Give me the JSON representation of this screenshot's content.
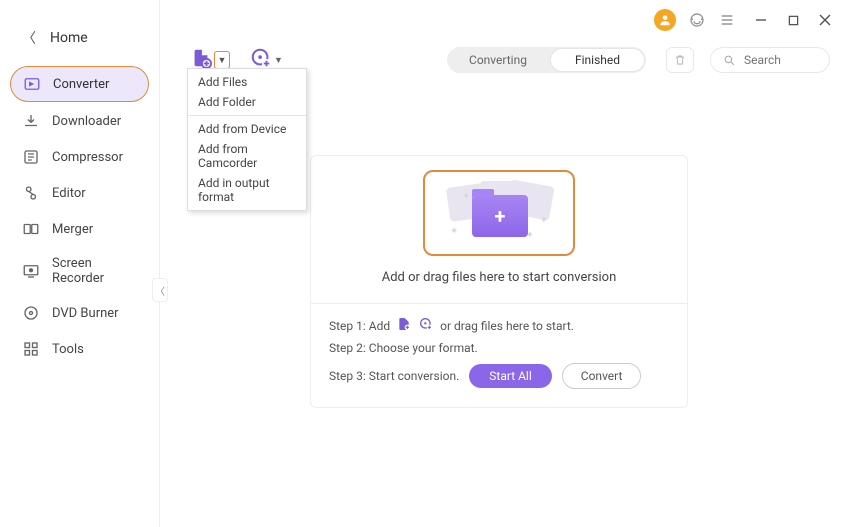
{
  "titlebar": {
    "avatar_initial": ""
  },
  "sidebar": {
    "home_label": "Home",
    "items": [
      {
        "label": "Converter",
        "icon": "converter-icon",
        "active": true
      },
      {
        "label": "Downloader",
        "icon": "downloader-icon"
      },
      {
        "label": "Compressor",
        "icon": "compressor-icon"
      },
      {
        "label": "Editor",
        "icon": "editor-icon"
      },
      {
        "label": "Merger",
        "icon": "merger-icon"
      },
      {
        "label": "Screen Recorder",
        "icon": "screen-recorder-icon"
      },
      {
        "label": "DVD Burner",
        "icon": "dvd-burner-icon"
      },
      {
        "label": "Tools",
        "icon": "tools-icon"
      }
    ]
  },
  "toolbar": {
    "tabs": {
      "converting": "Converting",
      "finished": "Finished"
    },
    "search_placeholder": "Search"
  },
  "add_menu": {
    "items_a": [
      "Add Files",
      "Add Folder"
    ],
    "items_b": [
      "Add from Device",
      "Add from Camcorder",
      "Add in output format"
    ]
  },
  "dropzone": {
    "title": "Add or drag files here to start conversion",
    "step1_prefix": "Step 1: Add",
    "step1_suffix": "or drag files here to start.",
    "step2": "Step 2: Choose your format.",
    "step3": "Step 3: Start conversion.",
    "start_all": "Start All",
    "convert": "Convert"
  }
}
